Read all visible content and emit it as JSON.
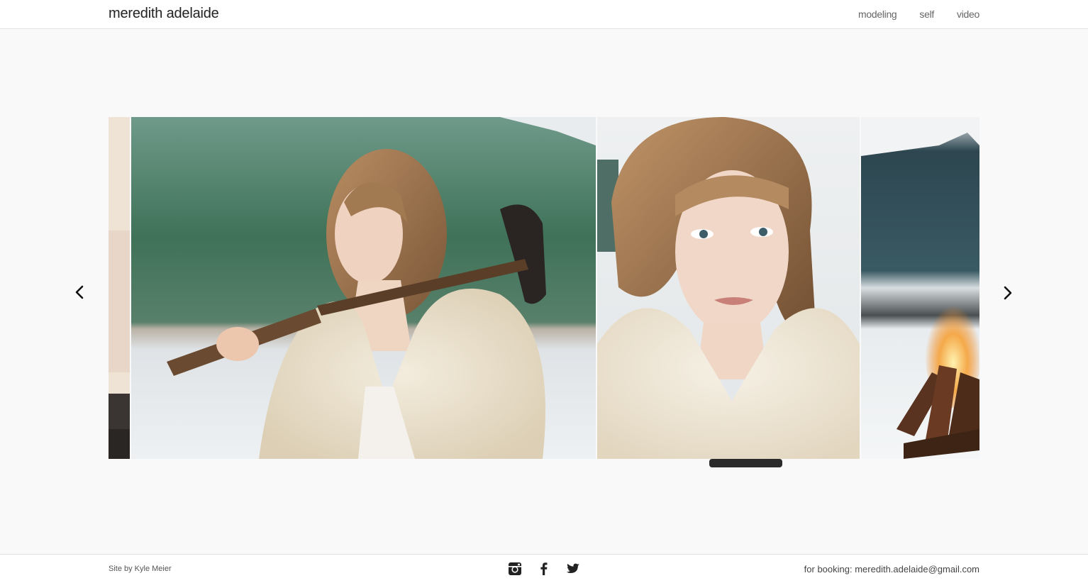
{
  "header": {
    "title": "meredith adelaide",
    "nav": [
      {
        "label": "modeling"
      },
      {
        "label": "self"
      },
      {
        "label": "video"
      }
    ]
  },
  "gallery": {
    "photos": [
      {
        "subject": "partial beach photo"
      },
      {
        "subject": "woman in fur coat holding axe by lake"
      },
      {
        "subject": "close-up portrait woman in fur coat"
      },
      {
        "subject": "campfire in snow by mountains"
      }
    ],
    "prev_icon": "chevron-left-icon",
    "next_icon": "chevron-right-icon"
  },
  "footer": {
    "credit": "Site by Kyle Meier",
    "social": [
      "instagram-icon",
      "facebook-icon",
      "twitter-icon"
    ],
    "booking_label": "for booking:",
    "booking_email": "meredith.adelaide@gmail.com"
  },
  "colors": {
    "background": "#f9f9f9",
    "header_bg": "#ffffff",
    "text": "#222222",
    "scrollbar": "#2b2b2b"
  }
}
